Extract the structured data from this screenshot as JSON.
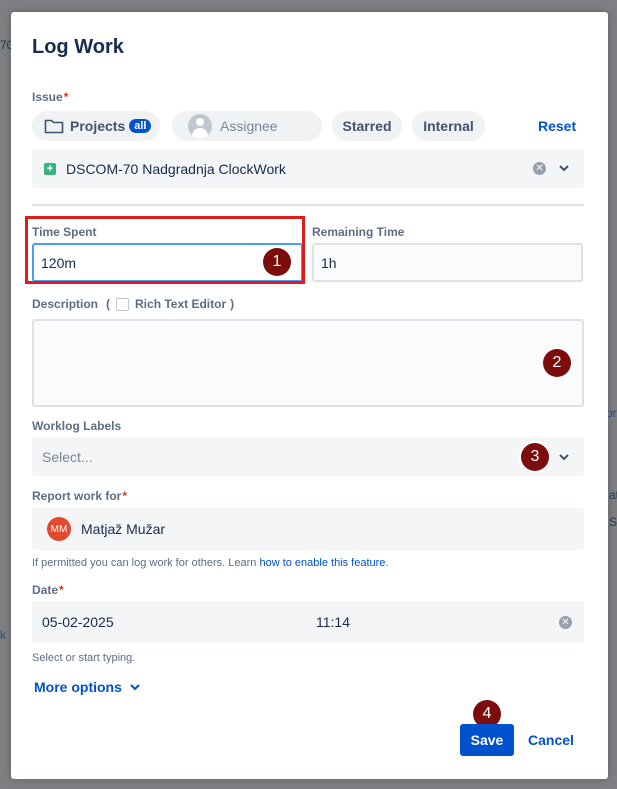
{
  "background": {
    "frag1": "70",
    "frag2": "ork",
    "frag3": "at",
    "frag4": "S",
    "frag5": "k"
  },
  "modal": {
    "title": "Log Work"
  },
  "issue": {
    "label": "Issue",
    "required_mark": "*",
    "filters": {
      "projects": "Projects",
      "projects_badge": "all",
      "assignee": "Assignee",
      "starred": "Starred",
      "internal": "Internal"
    },
    "reset": "Reset",
    "selected": "DSCOM-70 Nadgradnja ClockWork"
  },
  "time_spent": {
    "label": "Time Spent",
    "value": "120m"
  },
  "remaining_time": {
    "label": "Remaining Time",
    "value": "1h"
  },
  "description": {
    "label": "Description",
    "paren_open": "(",
    "rich_text_label": "Rich Text Editor",
    "paren_close": ")"
  },
  "worklog_labels": {
    "label": "Worklog Labels",
    "placeholder": "Select..."
  },
  "report_for": {
    "label": "Report work for",
    "required_mark": "*",
    "avatar_initials": "MM",
    "user": "Matjaž Mužar",
    "hint_prefix": "If permitted you can log work for others. Learn",
    "hint_link": "how to enable this feature",
    "hint_suffix": "."
  },
  "date": {
    "label": "Date",
    "required_mark": "*",
    "date_value": "05-02-2025",
    "time_value": "11:14",
    "hint": "Select or start typing."
  },
  "more_options": "More options",
  "actions": {
    "save": "Save",
    "cancel": "Cancel"
  },
  "markers": {
    "m1": "1",
    "m2": "2",
    "m3": "3",
    "m4": "4"
  },
  "colors": {
    "accent": "#0052cc",
    "highlight_box": "#e01b1b",
    "marker": "#7b0d0d",
    "issue_icon": "#36b37e"
  }
}
